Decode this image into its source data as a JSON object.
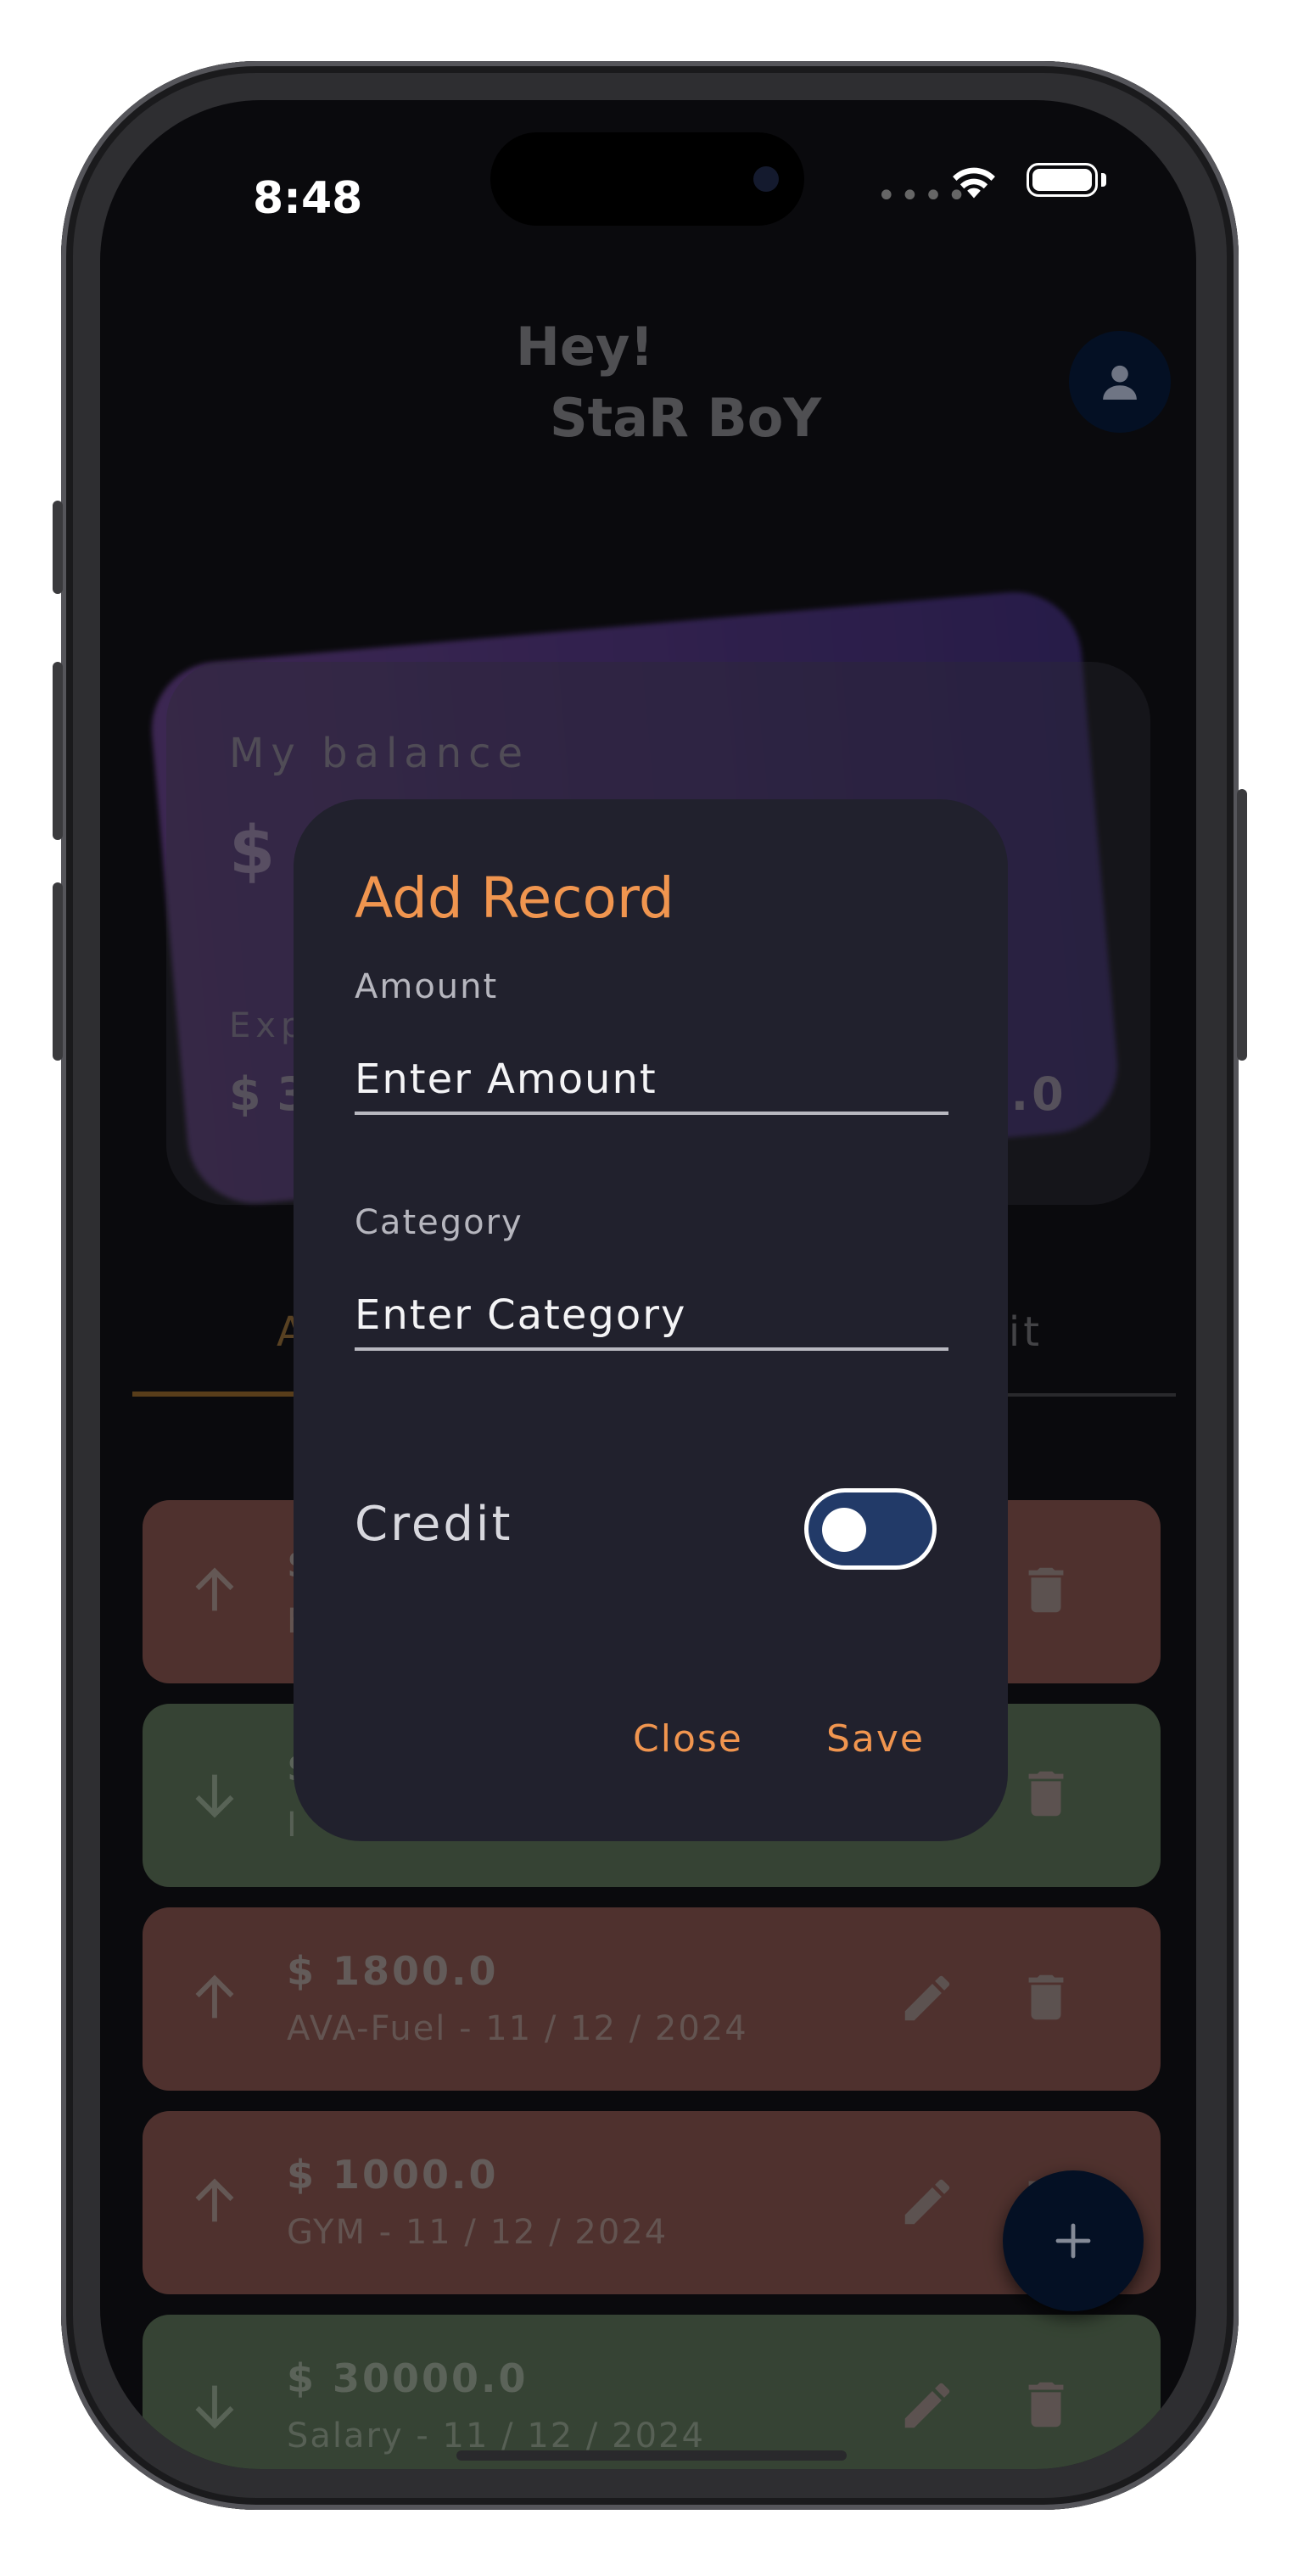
{
  "status_bar": {
    "time": "8:48"
  },
  "header": {
    "greeting": "Hey!",
    "username": "StaR BoY",
    "avatar_icon": "person-icon"
  },
  "balance_card": {
    "label": "My balance",
    "balance_visible": "$",
    "expense_label_visible": "Exp",
    "expense_value_visible": "$ 3",
    "income_value_visible": "0.0"
  },
  "tabs": {
    "left_visible": "A",
    "right_visible": "fit"
  },
  "records": [
    {
      "type": "debit",
      "amount": "$",
      "sub": "F"
    },
    {
      "type": "credit",
      "amount": "$",
      "sub": "I"
    },
    {
      "type": "debit",
      "amount": "$ 1800.0",
      "sub": "AVA-Fuel - 11 / 12 / 2024"
    },
    {
      "type": "debit",
      "amount": "$ 1000.0",
      "sub": "GYM - 11 / 12 / 2024"
    },
    {
      "type": "credit",
      "amount": "$ 30000.0",
      "sub": "Salary - 11 / 12 / 2024"
    }
  ],
  "dialog": {
    "title": "Add Record",
    "amount_label": "Amount",
    "amount_placeholder": "Enter Amount",
    "category_label": "Category",
    "category_placeholder": "Enter Category",
    "credit_label": "Credit",
    "credit_on": false,
    "close_label": "Close",
    "save_label": "Save"
  },
  "colors": {
    "accent": "#f0954f",
    "debit": "#6e4540",
    "credit": "#4b5e48",
    "dialog_bg": "#21212d",
    "fab": "#061733"
  },
  "fab": {
    "icon": "plus-icon"
  }
}
